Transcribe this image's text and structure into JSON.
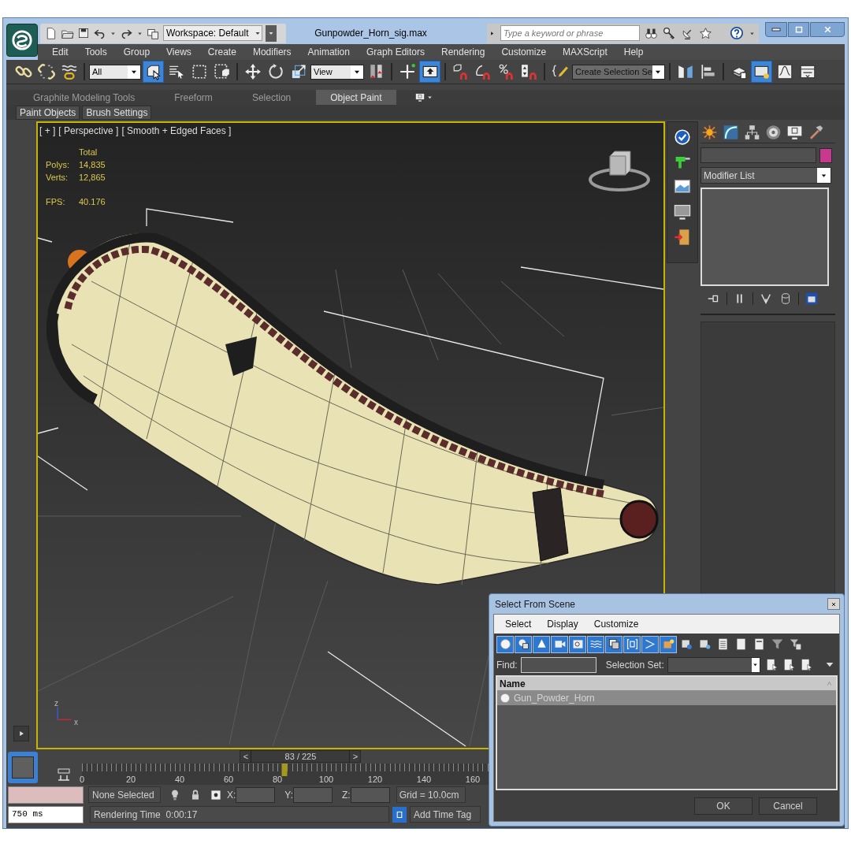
{
  "app": {
    "title": "Gunpowder_Horn_sig.max",
    "workspace": "Workspace: Default",
    "search": {
      "placeholder": "Type a keyword or phrase"
    }
  },
  "menu": [
    "Edit",
    "Tools",
    "Group",
    "Views",
    "Create",
    "Modifiers",
    "Animation",
    "Graph Editors",
    "Rendering",
    "Customize",
    "MAXScript",
    "Help"
  ],
  "main_toolbar": [
    {
      "kind": "icon",
      "selected": false
    },
    {
      "kind": "icon",
      "selected": false
    },
    {
      "kind": "icon",
      "selected": false
    },
    {
      "kind": "separator"
    },
    {
      "kind": "dropdown",
      "value": "All"
    },
    {
      "kind": "icon",
      "selected": true
    },
    {
      "kind": "icon",
      "selected": false
    },
    {
      "kind": "icon",
      "selected": false
    },
    {
      "kind": "icon",
      "selected": false
    },
    {
      "kind": "separator"
    },
    {
      "kind": "icon",
      "selected": false
    },
    {
      "kind": "icon",
      "selected": false
    },
    {
      "kind": "icon",
      "selected": false
    },
    {
      "kind": "dropdown",
      "value": "View"
    },
    {
      "kind": "icon",
      "selected": false
    },
    {
      "kind": "separator"
    },
    {
      "kind": "icon",
      "selected": false
    },
    {
      "kind": "icon",
      "selected": true
    },
    {
      "kind": "separator"
    },
    {
      "kind": "icon",
      "selected": false
    },
    {
      "kind": "icon",
      "selected": false
    },
    {
      "kind": "icon",
      "selected": false
    },
    {
      "kind": "icon",
      "selected": false
    },
    {
      "kind": "separator"
    },
    {
      "kind": "icon",
      "selected": false
    },
    {
      "kind": "dropdown",
      "value": "Create Selection Se"
    },
    {
      "kind": "separator"
    },
    {
      "kind": "icon",
      "selected": false
    },
    {
      "kind": "icon",
      "selected": false
    },
    {
      "kind": "separator"
    },
    {
      "kind": "icon",
      "selected": false
    },
    {
      "kind": "icon",
      "selected": true
    },
    {
      "kind": "icon",
      "selected": false
    },
    {
      "kind": "icon",
      "selected": false
    }
  ],
  "ribbon": {
    "tabs": [
      {
        "label": "Graphite Modeling Tools",
        "selected": false
      },
      {
        "label": "Freeform",
        "selected": false
      },
      {
        "label": "Selection",
        "selected": false
      },
      {
        "label": "Object Paint",
        "selected": true
      }
    ],
    "panels": [
      "Paint Objects",
      "Brush Settings"
    ]
  },
  "viewport": {
    "labels": [
      "[ + ]",
      "[ Perspective ]",
      "[ Smooth + Edged Faces ]"
    ],
    "stats": {
      "header": "Total",
      "rows": [
        {
          "label": "Polys:",
          "value": "14,835"
        },
        {
          "label": "Verts:",
          "value": "12,865"
        }
      ],
      "fps_label": "FPS:",
      "fps": "40.176"
    },
    "axis_labels": [
      "z",
      "x"
    ]
  },
  "command_panel": {
    "modifier_list": "Modifier List"
  },
  "timeline": {
    "prev": "<",
    "frame": "83 / 225",
    "next": ">",
    "level": 0.3689,
    "ticks": [
      "0",
      "20",
      "40",
      "60",
      "80",
      "100",
      "120",
      "140",
      "160"
    ]
  },
  "status_bar": {
    "selection": "None Selected",
    "x_label": "X:",
    "y_label": "Y:",
    "z_label": "Z:",
    "grid": "Grid = 10.0cm",
    "rendering_time": "Rendering Time  0:00:17",
    "time_tag": "Add Time Tag",
    "listener": "750 ms"
  },
  "dialog": {
    "title": "Select From Scene",
    "menu": [
      "Select",
      "Display",
      "Customize"
    ],
    "filters": [
      {
        "selected": true
      },
      {
        "selected": true
      },
      {
        "selected": true
      },
      {
        "selected": true
      },
      {
        "selected": true
      },
      {
        "selected": true
      },
      {
        "selected": true
      },
      {
        "selected": true
      },
      {
        "selected": true
      },
      {
        "selected": true
      },
      {
        "selected": false
      },
      {
        "selected": false
      },
      {
        "selected": false
      },
      {
        "selected": false
      },
      {
        "selected": false
      },
      {
        "selected": false
      },
      {
        "selected": false
      }
    ],
    "find_label": "Find:",
    "selection_set_label": "Selection Set:",
    "column": "Name",
    "rows": [
      {
        "name": "Gun_Powder_Horn",
        "selected": true
      }
    ],
    "buttons": [
      "OK",
      "Cancel"
    ]
  }
}
